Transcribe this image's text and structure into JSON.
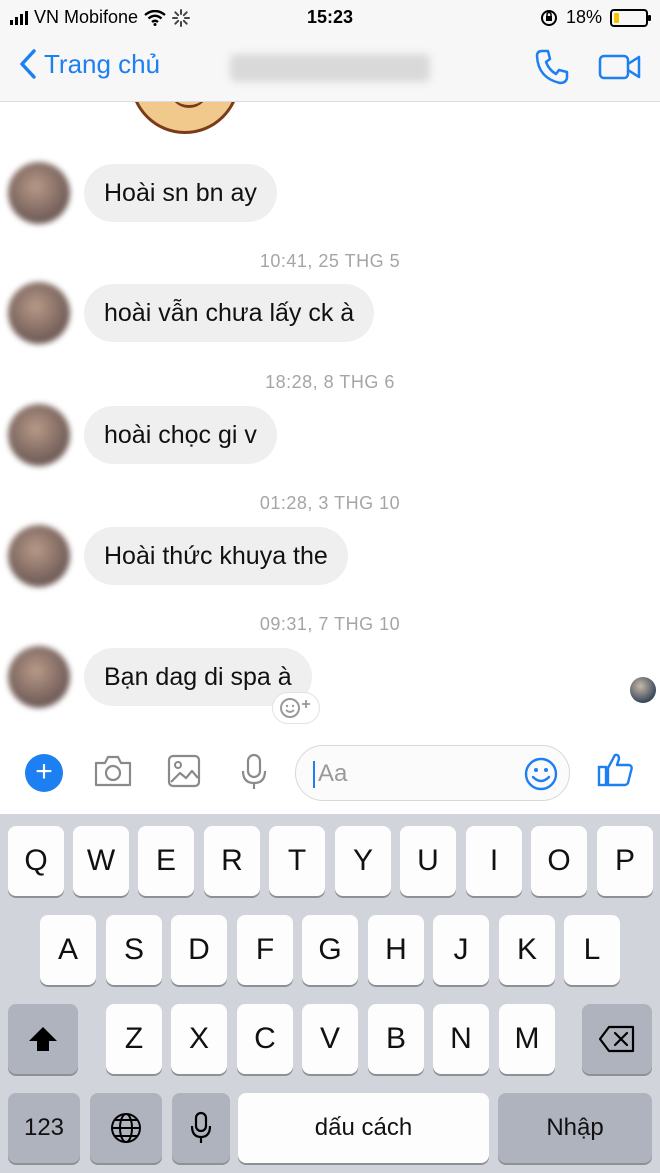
{
  "status_bar": {
    "carrier": "VN Mobifone",
    "time": "15:23",
    "battery_percent": "18%",
    "battery_level": 0.18,
    "battery_color": "#f5c400"
  },
  "nav": {
    "back_label": "Trang chủ",
    "icons": [
      "phone-icon",
      "video-camera-icon"
    ]
  },
  "messages": [
    {
      "text": "Hoài sn bn ay",
      "timestamp_before": ""
    },
    {
      "text": "hoài vẫn chưa lấy ck à",
      "timestamp_before": "10:41, 25 THG 5"
    },
    {
      "text": "hoài chọc gi v",
      "timestamp_before": "18:28, 8 THG 6"
    },
    {
      "text": "Hoài thức khuya the",
      "timestamp_before": "01:28, 3 THG 10"
    },
    {
      "text": "Bạn dag di spa à",
      "timestamp_before": "09:31, 7 THG 10"
    }
  ],
  "composer": {
    "placeholder": "Aa",
    "icons": [
      "plus-icon",
      "camera-icon",
      "image-icon",
      "microphone-icon",
      "emoji-icon",
      "thumbs-up-icon"
    ],
    "accent": "#1c7ff2"
  },
  "keyboard": {
    "row1": [
      "Q",
      "W",
      "E",
      "R",
      "T",
      "Y",
      "U",
      "I",
      "O",
      "P"
    ],
    "row2": [
      "A",
      "S",
      "D",
      "F",
      "G",
      "H",
      "J",
      "K",
      "L"
    ],
    "row3": [
      "Z",
      "X",
      "C",
      "V",
      "B",
      "N",
      "M"
    ],
    "numbers_key": "123",
    "space_key": "dấu cách",
    "return_key": "Nhập",
    "icons": [
      "shift-icon",
      "backspace-icon",
      "globe-icon",
      "dictation-icon"
    ]
  }
}
